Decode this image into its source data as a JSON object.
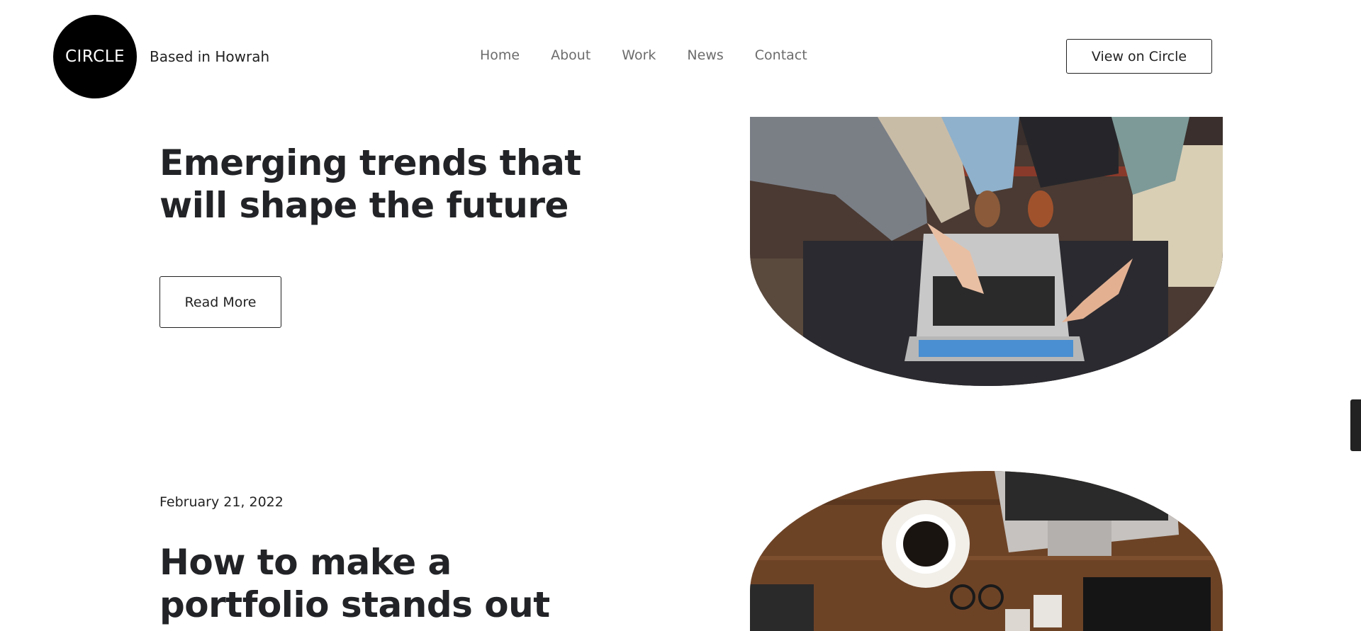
{
  "header": {
    "logo_text": "CIRCLE",
    "location": "Based in Howrah",
    "nav": [
      "Home",
      "About",
      "Work",
      "News",
      "Contact"
    ],
    "cta_label": "View on Circle"
  },
  "posts": [
    {
      "title": "Emerging trends that will shape the future",
      "read_more_label": "Read More",
      "image": "team-pointing-at-laptop-photo"
    },
    {
      "date": "February 21, 2022",
      "title": "How to make a portfolio stands out",
      "image": "desk-with-coffee-and-laptop-photo"
    }
  ],
  "colors": {
    "text": "#222326",
    "nav_text": "#6c6c6c",
    "logo_bg": "#000000"
  }
}
